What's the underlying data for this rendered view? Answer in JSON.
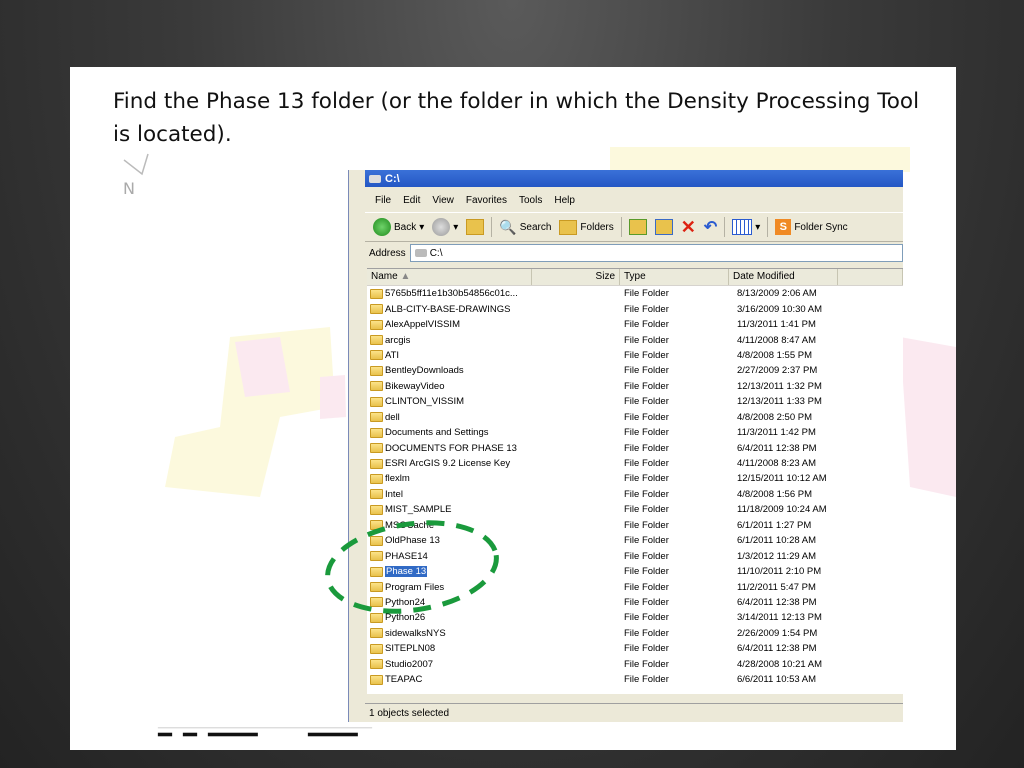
{
  "caption": "Find the Phase 13 folder (or the folder in which the Density Processing Tool is located).",
  "map": {
    "north_label": "N"
  },
  "window": {
    "title": "C:\\",
    "menu": [
      "File",
      "Edit",
      "View",
      "Favorites",
      "Tools",
      "Help"
    ],
    "toolbar": {
      "back": "Back",
      "search": "Search",
      "folders": "Folders",
      "folder_sync": "Folder Sync"
    },
    "address_label": "Address",
    "address_value": "C:\\",
    "columns": {
      "name": "Name",
      "size": "Size",
      "type": "Type",
      "date": "Date Modified"
    },
    "rows": [
      {
        "name": "5765b5ff11e1b30b54856c01c...",
        "type": "File Folder",
        "date": "8/13/2009 2:06 AM"
      },
      {
        "name": "ALB-CITY-BASE-DRAWINGS",
        "type": "File Folder",
        "date": "3/16/2009 10:30 AM"
      },
      {
        "name": "AlexAppelVISSIM",
        "type": "File Folder",
        "date": "11/3/2011 1:41 PM"
      },
      {
        "name": "arcgis",
        "type": "File Folder",
        "date": "4/11/2008 8:47 AM"
      },
      {
        "name": "ATI",
        "type": "File Folder",
        "date": "4/8/2008 1:55 PM"
      },
      {
        "name": "BentleyDownloads",
        "type": "File Folder",
        "date": "2/27/2009 2:37 PM"
      },
      {
        "name": "BikewayVideo",
        "type": "File Folder",
        "date": "12/13/2011 1:32 PM"
      },
      {
        "name": "CLINTON_VISSIM",
        "type": "File Folder",
        "date": "12/13/2011 1:33 PM"
      },
      {
        "name": "dell",
        "type": "File Folder",
        "date": "4/8/2008 2:50 PM"
      },
      {
        "name": "Documents and Settings",
        "type": "File Folder",
        "date": "11/3/2011 1:42 PM"
      },
      {
        "name": "DOCUMENTS FOR PHASE 13",
        "type": "File Folder",
        "date": "6/4/2011 12:38 PM"
      },
      {
        "name": "ESRI ArcGIS 9.2 License Key",
        "type": "File Folder",
        "date": "4/11/2008 8:23 AM"
      },
      {
        "name": "flexlm",
        "type": "File Folder",
        "date": "12/15/2011 10:12 AM"
      },
      {
        "name": "Intel",
        "type": "File Folder",
        "date": "4/8/2008 1:56 PM"
      },
      {
        "name": "MIST_SAMPLE",
        "type": "File Folder",
        "date": "11/18/2009 10:24 AM"
      },
      {
        "name": "MSOCache",
        "type": "File Folder",
        "date": "6/1/2011 1:27 PM"
      },
      {
        "name": "OldPhase 13",
        "type": "File Folder",
        "date": "6/1/2011 10:28 AM"
      },
      {
        "name": "PHASE14",
        "type": "File Folder",
        "date": "1/3/2012 11:29 AM"
      },
      {
        "name": "Phase 13",
        "type": "File Folder",
        "date": "11/10/2011 2:10 PM"
      },
      {
        "name": "Program Files",
        "type": "File Folder",
        "date": "11/2/2011 5:47 PM"
      },
      {
        "name": "Python24",
        "type": "File Folder",
        "date": "6/4/2011 12:38 PM"
      },
      {
        "name": "Python26",
        "type": "File Folder",
        "date": "3/14/2011 12:13 PM"
      },
      {
        "name": "sidewalksNYS",
        "type": "File Folder",
        "date": "2/26/2009 1:54 PM"
      },
      {
        "name": "SITEPLN08",
        "type": "File Folder",
        "date": "6/4/2011 12:38 PM"
      },
      {
        "name": "Studio2007",
        "type": "File Folder",
        "date": "4/28/2008 10:21 AM"
      },
      {
        "name": "TEAPAC",
        "type": "File Folder",
        "date": "6/6/2011 10:53 AM"
      }
    ],
    "selected_row": "Phase 13",
    "status": "1 objects selected"
  },
  "colors": {
    "highlight_dash": "#1a9a3c",
    "selection": "#316ac5"
  }
}
